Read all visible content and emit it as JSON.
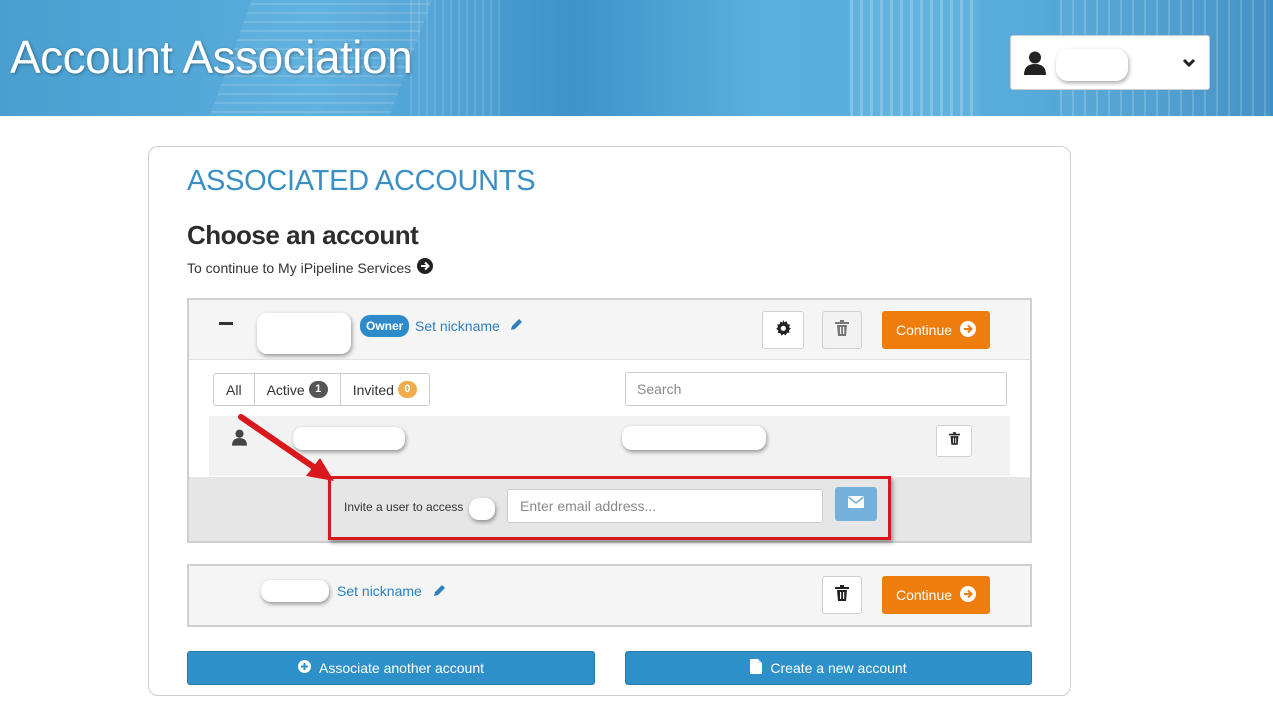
{
  "header": {
    "title": "Account Association",
    "user_menu": {
      "icon": "user-icon",
      "dropdown_icon": "chevron-down-icon"
    }
  },
  "main": {
    "section_title": "ASSOCIATED ACCOUNTS",
    "heading": "Choose an account",
    "subtext": "To continue to My iPipeline Services",
    "accounts": [
      {
        "expanded": true,
        "badge": "Owner",
        "set_nickname": "Set nickname",
        "continue_label": "Continue",
        "filters": [
          {
            "label": "All"
          },
          {
            "label": "Active",
            "count": "1",
            "count_color": "#555555"
          },
          {
            "label": "Invited",
            "count": "0",
            "count_color": "#efac4c"
          }
        ],
        "search_placeholder": "Search",
        "invite_label": "Invite a user to access",
        "email_placeholder": "Enter email address..."
      },
      {
        "expanded": false,
        "set_nickname": "Set nickname",
        "continue_label": "Continue"
      }
    ],
    "associate_button": "Associate another account",
    "create_button": "Create a new account"
  },
  "colors": {
    "accent": "#2e90c8",
    "continue": "#ef7d0d",
    "highlight_box": "#d9181e",
    "section_title": "#3a8fc5"
  }
}
